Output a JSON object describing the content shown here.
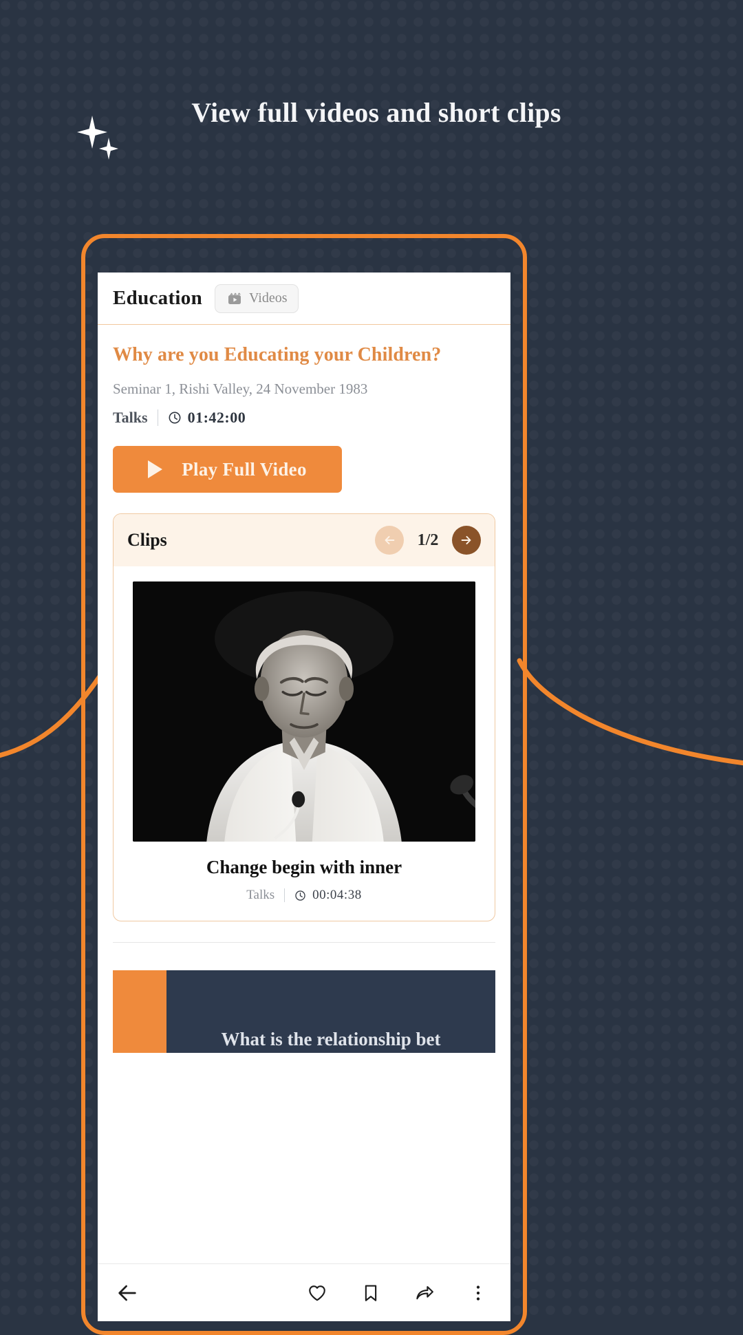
{
  "promo": {
    "headline": "View full videos and short clips",
    "sparkle_icon": "sparkle-icon",
    "accent_color": "#f2862c",
    "background_color": "#2a3443"
  },
  "app": {
    "topbar": {
      "title": "Education",
      "chip": {
        "icon": "video-film-icon",
        "label": "Videos"
      }
    },
    "talk": {
      "title": "Why are you Educating your Children?",
      "subtitle": "Seminar 1, Rishi Valley, 24 November 1983",
      "category": "Talks",
      "duration_icon": "clock-icon",
      "duration": "01:42:00",
      "play_button": {
        "icon": "play-icon",
        "label": "Play Full Video"
      }
    },
    "clips": {
      "header": "Clips",
      "pager": {
        "prev_icon": "arrow-left-icon",
        "next_icon": "arrow-right-icon",
        "count": "1/2"
      },
      "items": [
        {
          "caption": "Change begin with inner",
          "category": "Talks",
          "duration_icon": "clock-icon",
          "duration": "00:04:38",
          "thumbnail_alt": "black-and-white-speaker-portrait"
        }
      ]
    },
    "next_section_peek": {
      "text": "What is the relationship bet"
    },
    "bottom_bar": {
      "back_icon": "arrow-back-icon",
      "like_icon": "heart-icon",
      "bookmark_icon": "bookmark-icon",
      "share_icon": "share-icon",
      "more_icon": "more-vertical-icon"
    }
  }
}
